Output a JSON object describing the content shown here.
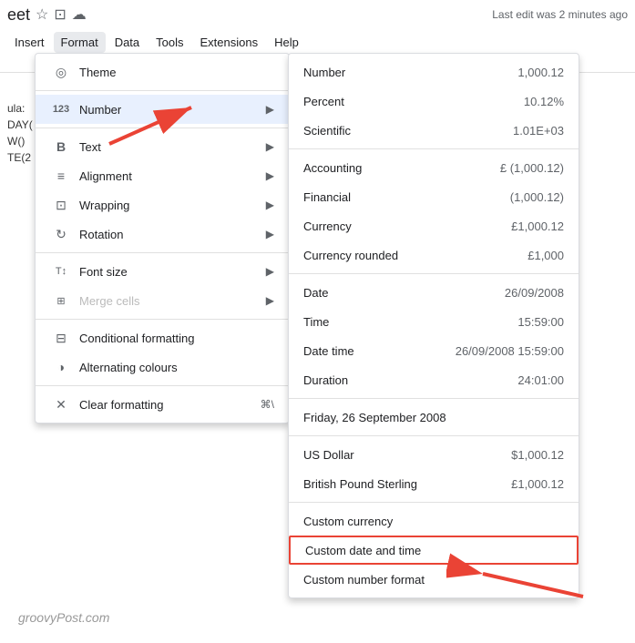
{
  "app": {
    "title": "eet",
    "title_icons": [
      "star",
      "folder",
      "cloud"
    ],
    "last_edit": "Last edit was 2 minutes ago"
  },
  "menu_bar": {
    "items": [
      "Insert",
      "Format",
      "Data",
      "Tools",
      "Extensions",
      "Help"
    ]
  },
  "cell_formula": {
    "lines": [
      "ula:",
      "DAY(",
      "W()",
      "TE(2"
    ]
  },
  "format_menu": {
    "title": "Format",
    "items": [
      {
        "icon": "◎",
        "label": "Theme",
        "shortcut": "",
        "has_arrow": false,
        "disabled": false
      },
      {
        "icon": "123",
        "label": "Number",
        "shortcut": "",
        "has_arrow": true,
        "disabled": false,
        "highlighted": true
      },
      {
        "icon": "B",
        "label": "Text",
        "shortcut": "",
        "has_arrow": true,
        "disabled": false
      },
      {
        "icon": "≡",
        "label": "Alignment",
        "shortcut": "",
        "has_arrow": true,
        "disabled": false
      },
      {
        "icon": "⊞",
        "label": "Wrapping",
        "shortcut": "",
        "has_arrow": true,
        "disabled": false
      },
      {
        "icon": "↻",
        "label": "Rotation",
        "shortcut": "",
        "has_arrow": true,
        "disabled": false
      },
      {
        "icon": "T↕",
        "label": "Font size",
        "shortcut": "",
        "has_arrow": true,
        "disabled": false
      },
      {
        "icon": "⊞⊞",
        "label": "Merge cells",
        "shortcut": "",
        "has_arrow": true,
        "disabled": true
      },
      {
        "icon": "⊟",
        "label": "Conditional formatting",
        "shortcut": "",
        "has_arrow": false,
        "disabled": false
      },
      {
        "icon": "◑",
        "label": "Alternating colours",
        "shortcut": "",
        "has_arrow": false,
        "disabled": false
      },
      {
        "icon": "✕",
        "label": "Clear formatting",
        "shortcut": "⌘\\",
        "has_arrow": false,
        "disabled": false
      }
    ]
  },
  "number_submenu": {
    "groups": [
      {
        "items": [
          {
            "label": "Number",
            "value": "1,000.12"
          },
          {
            "label": "Percent",
            "value": "10.12%"
          },
          {
            "label": "Scientific",
            "value": "1.01E+03"
          }
        ]
      },
      {
        "items": [
          {
            "label": "Accounting",
            "value": "£ (1,000.12)"
          },
          {
            "label": "Financial",
            "value": "(1,000.12)"
          },
          {
            "label": "Currency",
            "value": "£1,000.12"
          },
          {
            "label": "Currency rounded",
            "value": "£1,000"
          }
        ]
      },
      {
        "items": [
          {
            "label": "Date",
            "value": "26/09/2008"
          },
          {
            "label": "Time",
            "value": "15:59:00"
          },
          {
            "label": "Date time",
            "value": "26/09/2008 15:59:00"
          },
          {
            "label": "Duration",
            "value": "24:01:00"
          }
        ]
      },
      {
        "items": [
          {
            "label": "Friday, 26 September 2008",
            "value": ""
          }
        ]
      },
      {
        "items": [
          {
            "label": "US Dollar",
            "value": "$1,000.12"
          },
          {
            "label": "British Pound Sterling",
            "value": "£1,000.12"
          }
        ]
      },
      {
        "items": [
          {
            "label": "Custom currency",
            "value": ""
          },
          {
            "label": "Custom date and time",
            "value": "",
            "highlighted": true
          },
          {
            "label": "Custom number format",
            "value": ""
          }
        ]
      }
    ]
  },
  "watermark": {
    "text": "groovyPost.com"
  }
}
